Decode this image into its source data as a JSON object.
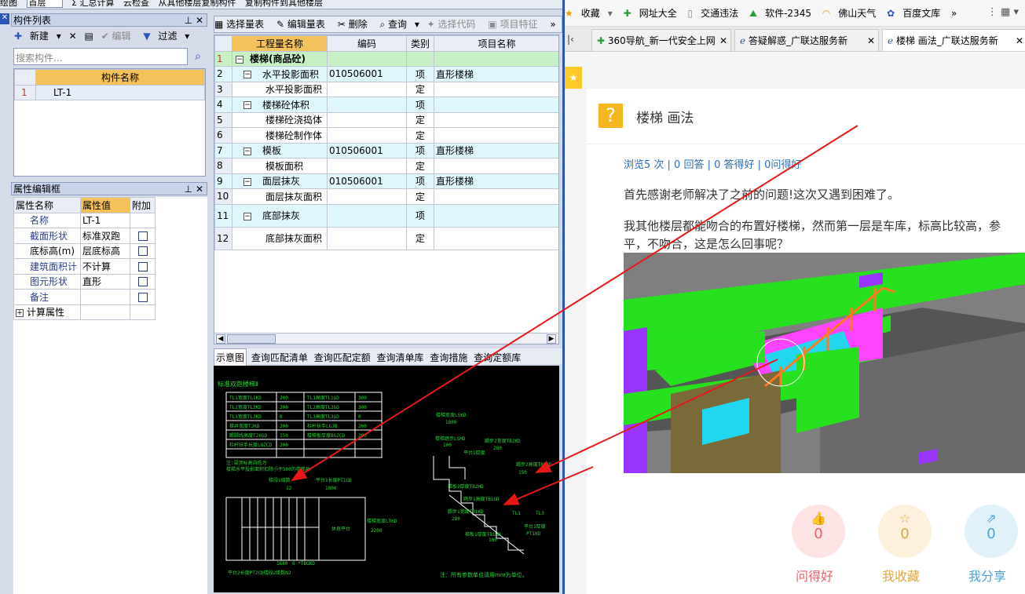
{
  "app": {
    "top_toolbar": [
      "绘图",
      "首层",
      "Σ 汇总计算",
      "云检查",
      "从其他楼层复制构件",
      "复制构件到其他楼层"
    ],
    "component_panel": {
      "title": "构件列表",
      "new_label": "新建",
      "edit_label": "编辑",
      "filter_label": "过滤",
      "search_placeholder": "搜索构件...",
      "col_header": "构件名称",
      "rows": [
        {
          "num": "1",
          "name": "LT-1"
        }
      ]
    },
    "props_panel": {
      "title": "属性编辑框",
      "headers": [
        "属性名称",
        "属性值",
        "附加"
      ],
      "rows": [
        {
          "name": "名称",
          "value": "LT-1"
        },
        {
          "name": "截面形状",
          "value": "标准双跑"
        },
        {
          "name": "底标高(m)",
          "value": "层底标高"
        },
        {
          "name": "建筑面积计",
          "value": "不计算"
        },
        {
          "name": "图元形状",
          "value": "直形"
        },
        {
          "name": "备注",
          "value": ""
        },
        {
          "name": "计算属性",
          "value": ""
        }
      ]
    },
    "qty_toolbar": {
      "select": "选择量表",
      "edit": "编辑量表",
      "delete": "删除",
      "query": "查询",
      "select_code": "选择代码",
      "item_feature": "项目特征"
    },
    "qty_table": {
      "headers": [
        "工程量名称",
        "编码",
        "类别",
        "项目名称"
      ],
      "rows": [
        {
          "num": "1",
          "name": "楼梯(商品砼)",
          "code": "",
          "type": "",
          "item": ""
        },
        {
          "num": "2",
          "name": "水平投影面积",
          "code": "010506001",
          "type": "项",
          "item": "直形楼梯"
        },
        {
          "num": "3",
          "name": "水平投影面积",
          "code": "",
          "type": "定",
          "item": ""
        },
        {
          "num": "4",
          "name": "楼梯砼体积",
          "code": "",
          "type": "项",
          "item": ""
        },
        {
          "num": "5",
          "name": "楼梯砼浇捣体",
          "code": "",
          "type": "定",
          "item": ""
        },
        {
          "num": "6",
          "name": "楼梯砼制作体",
          "code": "",
          "type": "定",
          "item": ""
        },
        {
          "num": "7",
          "name": "模板",
          "code": "010506001",
          "type": "项",
          "item": "直形楼梯"
        },
        {
          "num": "8",
          "name": "模板面积",
          "code": "",
          "type": "定",
          "item": ""
        },
        {
          "num": "9",
          "name": "面层抹灰",
          "code": "010506001",
          "type": "项",
          "item": "直形楼梯"
        },
        {
          "num": "10",
          "name": "面层抹灰面积",
          "code": "",
          "type": "定",
          "item": ""
        },
        {
          "num": "11",
          "name": "底部抹灰",
          "code": "",
          "type": "项",
          "item": ""
        },
        {
          "num": "12",
          "name": "底部抹灰面积",
          "code": "",
          "type": "定",
          "item": ""
        }
      ]
    },
    "bottom_tabs": [
      "示意图",
      "查询匹配清单",
      "查询匹配定额",
      "查询清单库",
      "查询措施",
      "查询定额库"
    ],
    "diagram": {
      "title": "标准双跑楼梯Ⅱ",
      "note": "注：所有参数单位请用mm为单位。"
    }
  },
  "browser": {
    "bookmarks": [
      "收藏",
      "网址大全",
      "交通违法",
      "软件-2345",
      "佛山天气",
      "百度文库"
    ],
    "tabs": [
      "360导航_新一代安全上网",
      "答疑解惑_广联达服务新",
      "楼梯 画法_广联达服务新"
    ],
    "question": {
      "title": "楼梯 画法",
      "stats": "浏览5 次 | 0 回答 | 0 答得好 | 0问得好",
      "p1": "首先感谢老师解决了之前的问题!这次又遇到困难了。",
      "p2": "我其他楼层都能吻合的布置好楼梯，然而第一层是车库，标高比较高，参",
      "p3": "平，不吻合，这是怎么回事呢？"
    },
    "actions": [
      {
        "count": "0",
        "label": "问得好",
        "color": "#e8626a",
        "bg": "#fde3e4"
      },
      {
        "count": "0",
        "label": "我收藏",
        "color": "#e0a642",
        "bg": "#fdf0dc"
      },
      {
        "count": "0",
        "label": "我分享",
        "color": "#4aa3d8",
        "bg": "#e1f1fa"
      }
    ]
  }
}
